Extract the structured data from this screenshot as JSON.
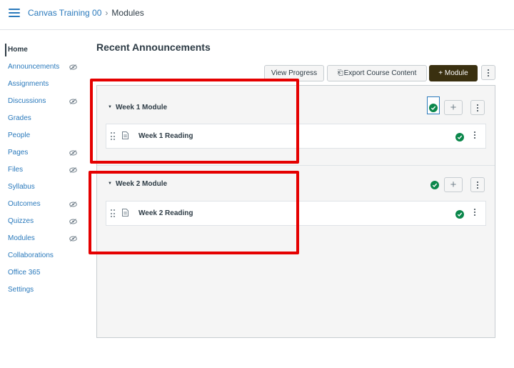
{
  "header": {
    "course": "Canvas Training 00",
    "separator": "›",
    "current": "Modules"
  },
  "sidebar": {
    "items": [
      {
        "label": "Home",
        "active": true,
        "hidden": false
      },
      {
        "label": "Announcements",
        "hidden": true
      },
      {
        "label": "Assignments",
        "hidden": false
      },
      {
        "label": "Discussions",
        "hidden": true
      },
      {
        "label": "Grades",
        "hidden": false
      },
      {
        "label": "People",
        "hidden": false
      },
      {
        "label": "Pages",
        "hidden": true
      },
      {
        "label": "Files",
        "hidden": true
      },
      {
        "label": "Syllabus",
        "hidden": false
      },
      {
        "label": "Outcomes",
        "hidden": true
      },
      {
        "label": "Quizzes",
        "hidden": true
      },
      {
        "label": "Modules",
        "hidden": true
      },
      {
        "label": "Collaborations",
        "hidden": false
      },
      {
        "label": "Office 365",
        "hidden": false
      },
      {
        "label": "Settings",
        "hidden": false
      }
    ]
  },
  "main": {
    "title": "Recent Announcements",
    "toolbar": {
      "view_progress": "View Progress",
      "export": "Export Course Content",
      "export_icon": "⎗",
      "add_module": "+ Module"
    },
    "modules": [
      {
        "name": "Week 1 Module",
        "published": true,
        "items": [
          {
            "title": "Week 1 Reading",
            "published": true
          }
        ]
      },
      {
        "name": "Week 2 Module",
        "published": true,
        "items": [
          {
            "title": "Week 2 Reading",
            "published": true
          }
        ]
      }
    ],
    "add_glyph": "+",
    "toggle_glyph": "▼"
  },
  "colors": {
    "link": "#2b7abc",
    "published": "#0b874b",
    "highlight": "#e50000",
    "primary_button": "#3a3010"
  },
  "icons": [
    "hamburger-icon",
    "eye-off-icon",
    "checkmark-icon",
    "plus-icon",
    "kebab-icon",
    "drag-handle-icon",
    "page-icon",
    "caret-down-icon"
  ]
}
